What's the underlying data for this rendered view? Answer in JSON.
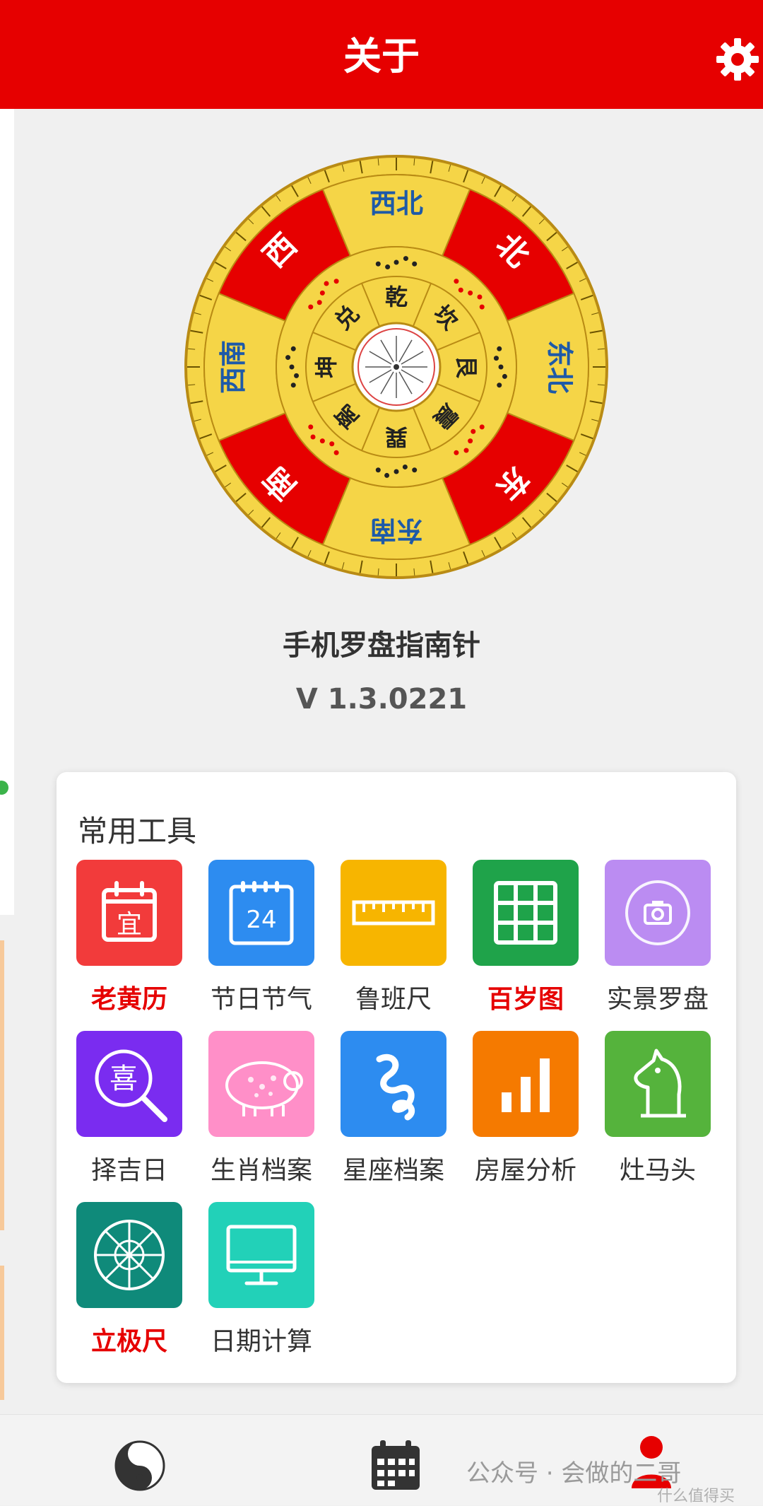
{
  "header": {
    "title": "关于",
    "settings_icon": "gear-icon"
  },
  "compass": {
    "outer_directions": [
      "北",
      "东北",
      "东",
      "东南",
      "南",
      "西南",
      "西",
      "西北"
    ],
    "inner_trigrams": [
      "坎",
      "艮",
      "震",
      "巽",
      "离",
      "坤",
      "兑",
      "乾"
    ],
    "colors": {
      "gold": "#f5d547",
      "red": "#e60000",
      "blue": "#1e5aa8",
      "ring": "#b98b14"
    }
  },
  "app": {
    "name": "手机罗盘指南针",
    "version": "V 1.3.0221"
  },
  "tools": {
    "title": "常用工具",
    "items": [
      {
        "label": "老黄历",
        "icon": "calendar-yi-icon",
        "color": "#f23b3b",
        "highlight": true
      },
      {
        "label": "节日节气",
        "icon": "calendar-24-icon",
        "color": "#2d8cf0",
        "highlight": false,
        "badge": "24"
      },
      {
        "label": "鲁班尺",
        "icon": "ruler-icon",
        "color": "#f7b500",
        "highlight": false
      },
      {
        "label": "百岁图",
        "icon": "grid-icon",
        "color": "#1fa34a",
        "highlight": true
      },
      {
        "label": "实景罗盘",
        "icon": "camera-icon",
        "color": "#bb8cf2",
        "highlight": false
      },
      {
        "label": "择吉日",
        "icon": "magnifier-xi-icon",
        "color": "#7a2cf0",
        "highlight": false,
        "badge": "喜"
      },
      {
        "label": "生肖档案",
        "icon": "pig-icon",
        "color": "#ff8fc8",
        "highlight": false
      },
      {
        "label": "星座档案",
        "icon": "zodiac-icon",
        "color": "#2d8cf0",
        "highlight": false
      },
      {
        "label": "房屋分析",
        "icon": "bar-chart-icon",
        "color": "#f57a00",
        "highlight": false
      },
      {
        "label": "灶马头",
        "icon": "horse-icon",
        "color": "#55b33c",
        "highlight": false
      },
      {
        "label": "立极尺",
        "icon": "wheel-icon",
        "color": "#0f8a7a",
        "highlight": true
      },
      {
        "label": "日期计算",
        "icon": "monitor-icon",
        "color": "#22d1b8",
        "highlight": false
      }
    ]
  },
  "bottom_nav": {
    "items": [
      {
        "icon": "yinyang-icon"
      },
      {
        "icon": "calendar-icon"
      },
      {
        "icon": "profile-icon"
      }
    ],
    "watermark": "公众号 · 会做的二哥",
    "watermark2": "什么值得买"
  }
}
